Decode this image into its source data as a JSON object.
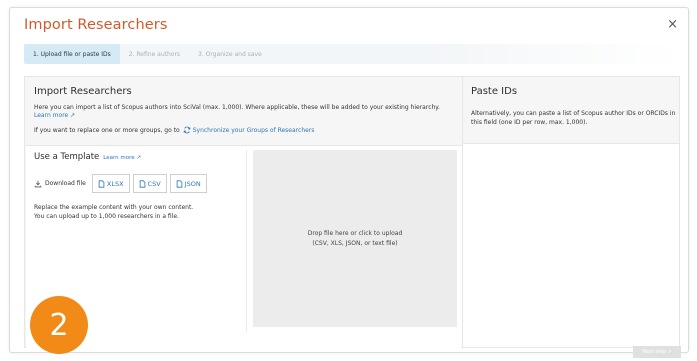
{
  "dialog": {
    "title": "Import Researchers",
    "close_label": "×"
  },
  "steps": [
    {
      "label": "1. Upload file or paste IDs",
      "active": true
    },
    {
      "label": "2. Refine authors",
      "active": false
    },
    {
      "label": "3. Organize and save",
      "active": false
    }
  ],
  "import_panel": {
    "title": "Import Researchers",
    "description": "Here you can import a list of Scopus authors into SciVal (max. 1,000). Where applicable, these will be added to your existing hierarchy.",
    "learn_more": "Learn more ↗",
    "sync_prefix": "If you want to replace one or more groups, go to",
    "sync_link": "Synchronize your Groups of Researchers"
  },
  "template": {
    "title": "Use a Template",
    "learn_more": "Learn more ↗",
    "download_label": "Download file",
    "formats": [
      "XLSX",
      "CSV",
      "JSON"
    ],
    "line1": "Replace the example content with your own content.",
    "line2": "You can upload up to 1,000 researchers in a file."
  },
  "dropzone": {
    "line1": "Drop file here or click to upload",
    "line2": "(CSV, XLS, JSON, or text file)"
  },
  "paste_panel": {
    "title": "Paste IDs",
    "description": "Alternatively, you can paste a list of Scopus author IDs or ORCIDs in this field (one ID per row, max. 1,000)."
  },
  "callout_number": "2",
  "next_button": "Next step  >",
  "colors": {
    "title": "#d25a2a",
    "link": "#2b78b7",
    "active_step": "#d4eaf5",
    "badge": "#f18a16"
  }
}
